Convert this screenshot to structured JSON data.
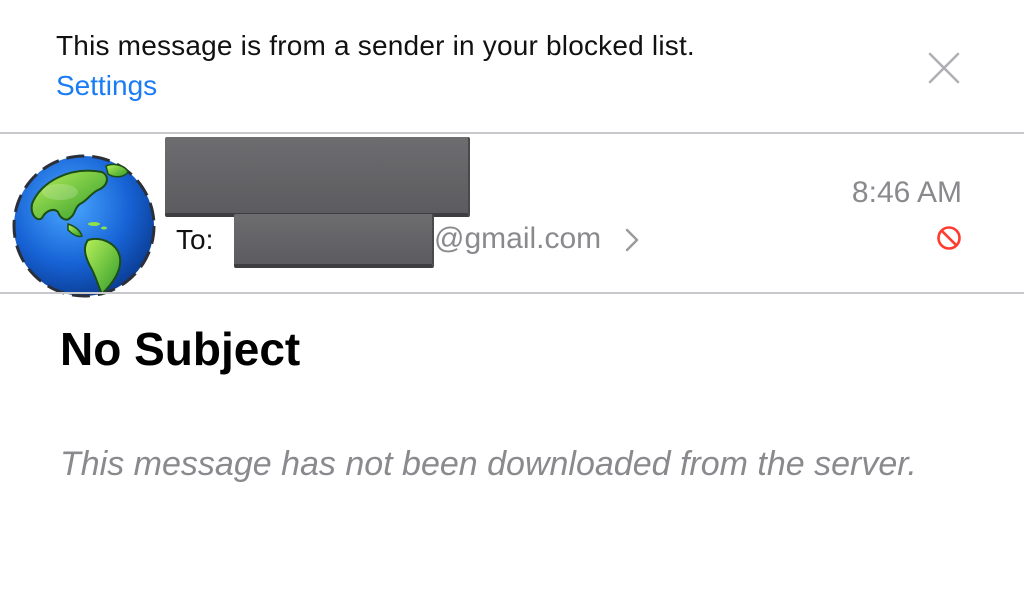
{
  "banner": {
    "message": "This message is from a sender in your blocked list.",
    "settings_link": "Settings",
    "close_icon": "close-icon"
  },
  "header": {
    "avatar_icon": "globe-icon",
    "to_label": "To:",
    "recipient_domain": "@gmail.com",
    "recipient_chevron": "chevron-right-icon",
    "time": "8:46 AM",
    "blocked_icon": "blocked-icon",
    "blocked_color": "#ff3b30"
  },
  "message": {
    "subject": "No Subject",
    "body": "This message has not been downloaded from the server."
  },
  "colors": {
    "link": "#1a7cf5",
    "secondary_text": "#8a8a8e",
    "divider": "#c8c8cc"
  }
}
